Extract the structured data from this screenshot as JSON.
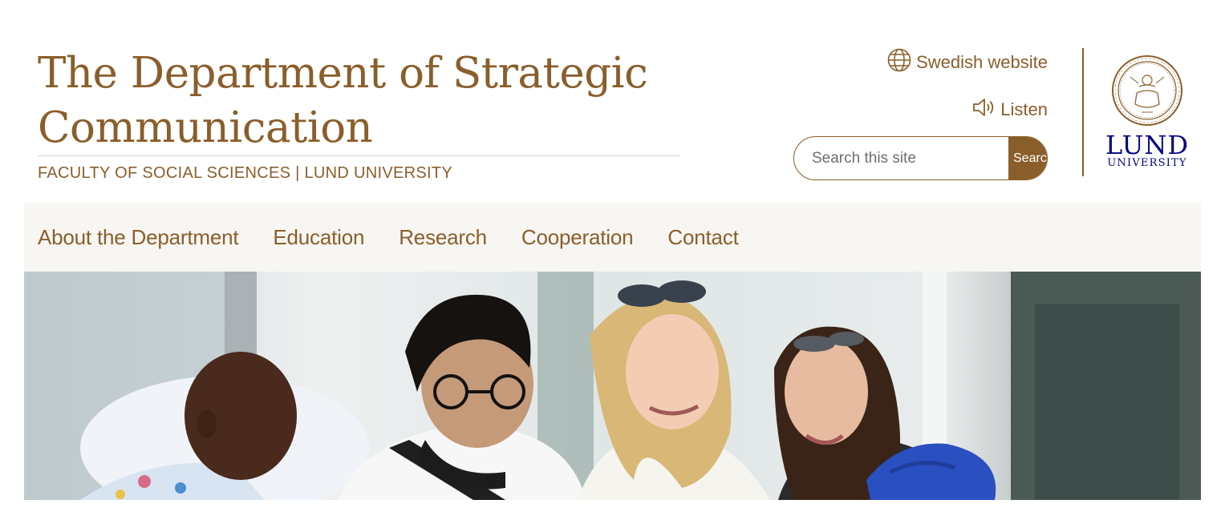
{
  "header": {
    "title": "The Department of Strategic Communication",
    "subtitle": "FACULTY OF SOCIAL SCIENCES | LUND UNIVERSITY"
  },
  "utility": {
    "language_link": "Swedish website",
    "language_icon": "globe-icon",
    "listen_link": "Listen",
    "listen_icon": "speaker-icon"
  },
  "search": {
    "placeholder": "Search this site",
    "button_label": "Search"
  },
  "logo": {
    "name": "LUND",
    "sub": "UNIVERSITY"
  },
  "nav": {
    "items": [
      {
        "label": "About the Department"
      },
      {
        "label": "Education"
      },
      {
        "label": "Research"
      },
      {
        "label": "Cooperation"
      },
      {
        "label": "Contact"
      }
    ]
  },
  "colors": {
    "brand": "#8a5e2b",
    "nav_bg": "#f7f6f3",
    "logo_blue": "#000080"
  }
}
